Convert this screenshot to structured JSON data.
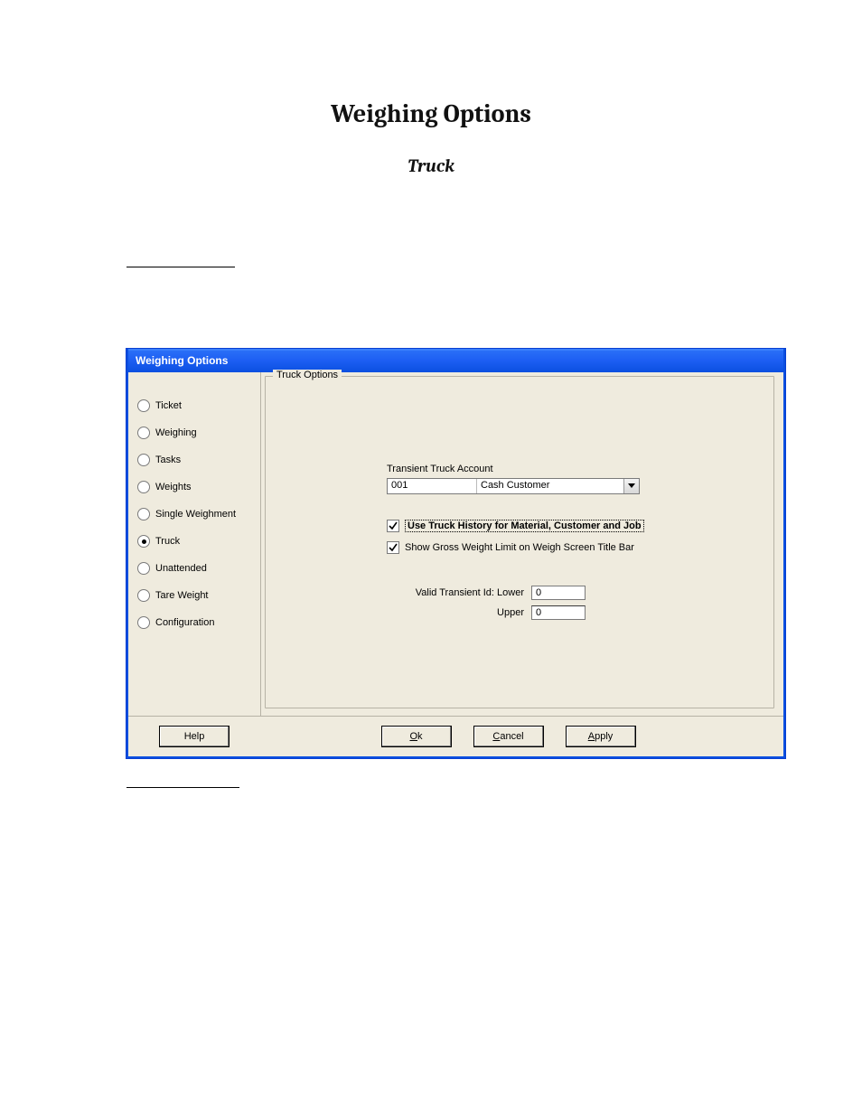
{
  "page": {
    "title": "Weighing Options",
    "subtitle": "Truck"
  },
  "dialog": {
    "title": "Weighing Options",
    "groupbox_title": "Truck Options",
    "sidebar": {
      "items": [
        {
          "label": "Ticket",
          "selected": false
        },
        {
          "label": "Weighing",
          "selected": false
        },
        {
          "label": "Tasks",
          "selected": false
        },
        {
          "label": "Weights",
          "selected": false
        },
        {
          "label": "Single Weighment",
          "selected": false
        },
        {
          "label": "Truck",
          "selected": true
        },
        {
          "label": "Unattended",
          "selected": false
        },
        {
          "label": "Tare Weight",
          "selected": false
        },
        {
          "label": "Configuration",
          "selected": false
        }
      ]
    },
    "form": {
      "transient_label": "Transient Truck Account",
      "transient_code": "001",
      "transient_name": "Cash Customer",
      "check_history": {
        "checked": true,
        "label": "Use Truck History for Material, Customer and Job"
      },
      "check_gross": {
        "checked": true,
        "label": "Show Gross Weight Limit on Weigh Screen Title Bar"
      },
      "valid_label_lower": "Valid Transient Id:  Lower",
      "valid_label_upper": "Upper",
      "valid_lower": "0",
      "valid_upper": "0"
    },
    "buttons": {
      "help": "Help",
      "ok_u": "O",
      "ok_rest": "k",
      "cancel_u": "C",
      "cancel_rest": "ancel",
      "apply_u": "A",
      "apply_rest": "pply"
    }
  }
}
